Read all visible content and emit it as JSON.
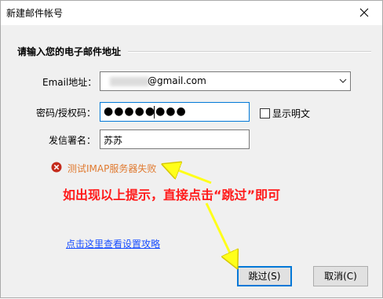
{
  "window": {
    "title": "新建邮件帐号",
    "close_icon": "close-icon"
  },
  "section": {
    "title": "请输入您的电子邮件地址"
  },
  "form": {
    "email_label": "Email地址：",
    "email_value": "@gmail.com",
    "password_label": "密码/授权码：",
    "password_value": "●●●●●●●●",
    "show_password_label": "显示明文",
    "show_password_checked": false,
    "signature_label": "发信署名：",
    "signature_value": "苏苏"
  },
  "error": {
    "text": "测试IMAP服务器失败",
    "icon": "error-circle-icon",
    "color": "#e07a30"
  },
  "annotation": {
    "text": "如出现以上提示，直接点击“跳过”即可",
    "color": "#ff1a1a"
  },
  "link": {
    "text": "点击这里查看设置攻略"
  },
  "buttons": {
    "skip": "跳过(S)",
    "cancel": "取消(C)"
  },
  "colors": {
    "arrow": "#ffff1a",
    "focus": "#0078d7",
    "dialog_bg": "#f0f0f0"
  }
}
